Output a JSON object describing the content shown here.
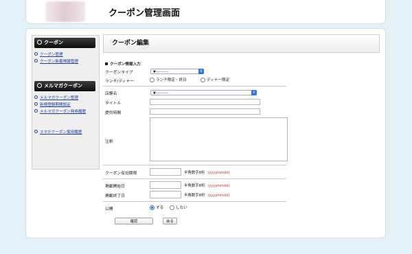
{
  "header": {
    "title": "クーポン管理画面"
  },
  "sidebar": {
    "sections": [
      {
        "title": "クーポン",
        "links": [
          "クーポン管理",
          "クーポン新着情報管理"
        ]
      },
      {
        "title": "メルマガクーポン",
        "links": [
          "メルマガクーポン管理",
          "新規登録期間設定",
          "メルマガクーポン発券履歴"
        ]
      }
    ],
    "extra_link": "スマホクーポン使用履歴"
  },
  "content": {
    "title": "クーポン編集",
    "section_label": "クーポン情報入力",
    "form": {
      "coupon_type": {
        "label": "クーポンタイプ",
        "value": "▼----------"
      },
      "lunch_dinner": {
        "label": "ランチ/ディナー",
        "options": [
          "ランチ限定・終日",
          "ディナー限定"
        ],
        "selected": null
      },
      "store": {
        "label": "店舗名",
        "value": "▼----------"
      },
      "title": {
        "label": "タイトル",
        "value": ""
      },
      "period": {
        "label": "提供時間",
        "value": ""
      },
      "note": {
        "label": "注釈",
        "value": ""
      },
      "valid_until": {
        "label": "クーポン有効期限",
        "value": "",
        "hint": "半角数字8桁",
        "format": "(yyyymmdd)"
      },
      "publish_start": {
        "label": "掲載開始日",
        "value": "",
        "hint": "半角数字8桁",
        "format": "(yyyymmdd)"
      },
      "publish_end": {
        "label": "掲載終了日",
        "value": "",
        "hint": "半角数字8桁",
        "format": "(yyyymmdd)"
      },
      "public": {
        "label": "公開",
        "options": [
          "する",
          "しない"
        ],
        "selected": "する"
      }
    },
    "buttons": {
      "confirm": "確認",
      "back": "戻る"
    }
  }
}
